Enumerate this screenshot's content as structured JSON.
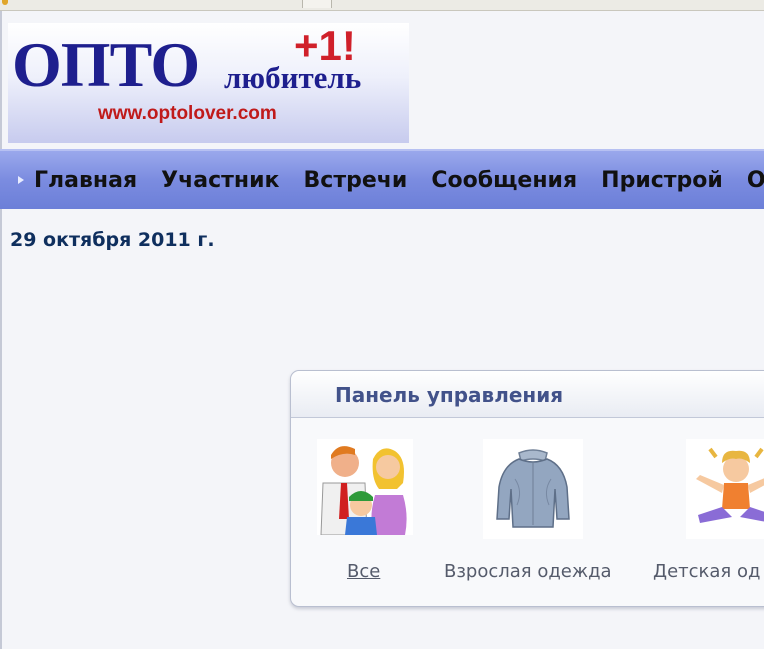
{
  "logo": {
    "main_text": "ОПТО",
    "sub_text": "любитель",
    "badge_text": "+1!",
    "url_text": "www.optolover.com"
  },
  "nav": {
    "items": [
      "Главная",
      "Участник",
      "Встречи",
      "Сообщения",
      "Пристрой",
      "Ост"
    ]
  },
  "date": "29 октября 2011 г.",
  "panel": {
    "title": "Панель управления",
    "categories": [
      {
        "label": "Все",
        "icon": "family-icon"
      },
      {
        "label": "Взрослая одежда",
        "icon": "sweater-icon"
      },
      {
        "label": "Детская од",
        "icon": "child-icon"
      }
    ]
  },
  "colors": {
    "nav_bar": "#7b8ce0",
    "logo_text": "#1e1f8e",
    "logo_accent": "#d0202a",
    "date_text": "#0f2f5e",
    "panel_title": "#42528a"
  }
}
